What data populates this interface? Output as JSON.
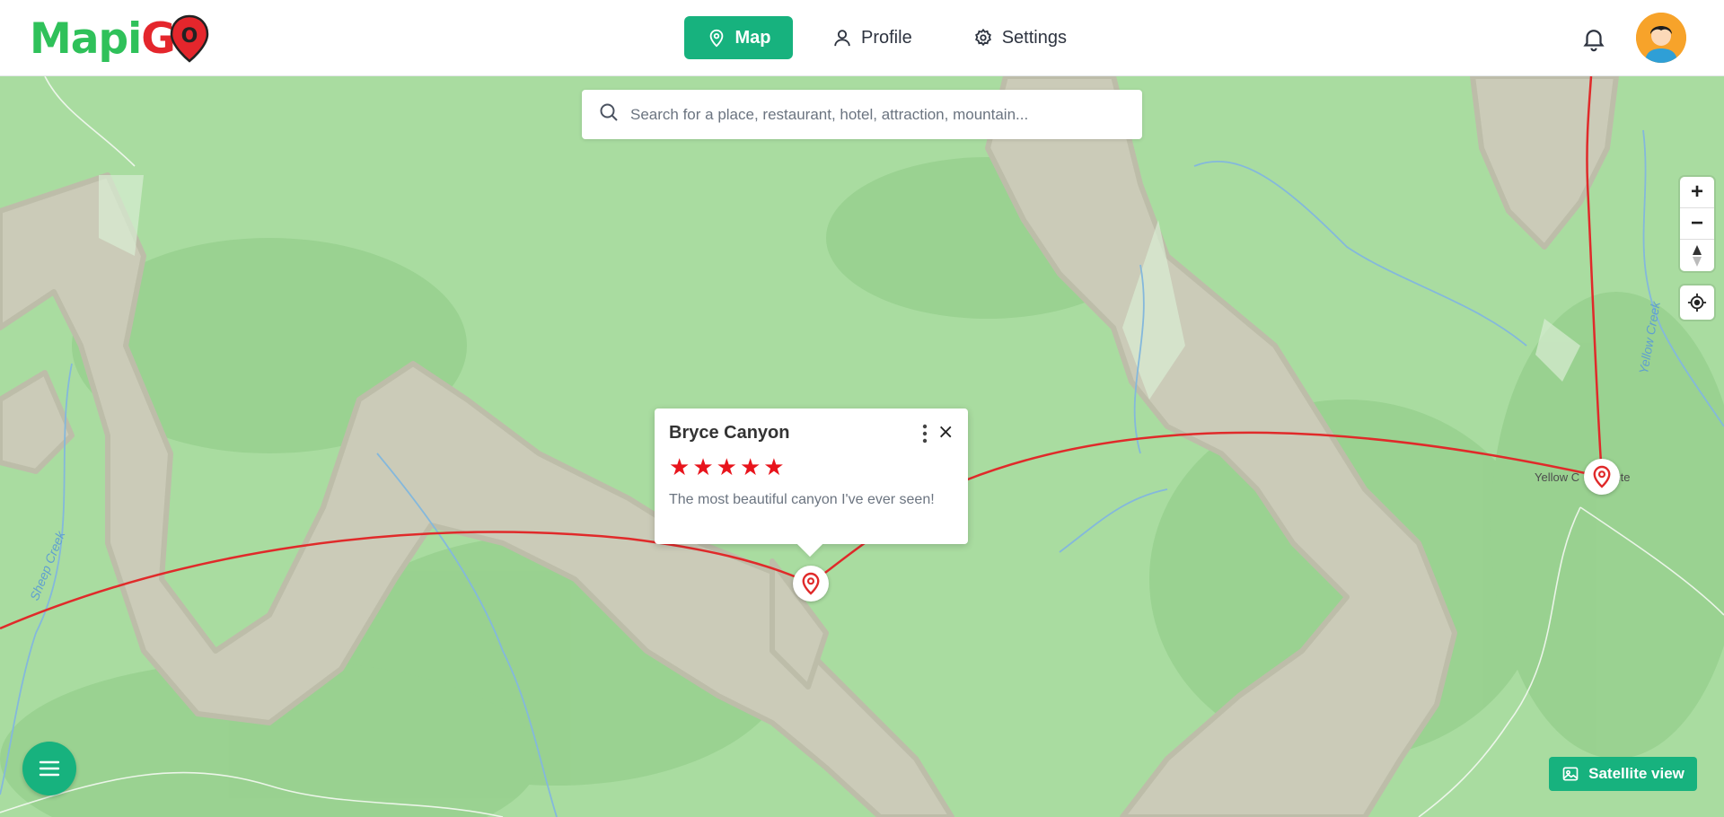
{
  "app": {
    "logo_text_1": "Mapi",
    "logo_text_2": "G",
    "logo_text_3": "O"
  },
  "nav": {
    "items": [
      {
        "label": "Map",
        "icon": "map-pin-icon",
        "active": true
      },
      {
        "label": "Profile",
        "icon": "user-icon",
        "active": false
      },
      {
        "label": "Settings",
        "icon": "gear-icon",
        "active": false
      }
    ]
  },
  "header": {
    "bell_icon": "bell-icon",
    "avatar_icon": "user-avatar"
  },
  "search": {
    "placeholder": "Search for a place, restaurant, hotel, attraction, mountain...",
    "value": ""
  },
  "map_controls": {
    "zoom_in": "+",
    "zoom_out": "−",
    "compass": "compass-icon",
    "locate": "locate-icon"
  },
  "popup": {
    "title": "Bryce Canyon",
    "rating": 5,
    "stars": "★★★★★",
    "review": "The most beautiful canyon I've ever seen!",
    "close": "×"
  },
  "map_labels": {
    "campsite": "Yellow C   ampsite",
    "creek_1": "Sheep Creek",
    "creek_2": "Yellow Creek"
  },
  "buttons": {
    "satellite": "Satellite view"
  },
  "colors": {
    "accent": "#17b27e",
    "route": "#e02a2a",
    "map_green": "#a9dca0",
    "terrain": "#cbcbb8"
  }
}
